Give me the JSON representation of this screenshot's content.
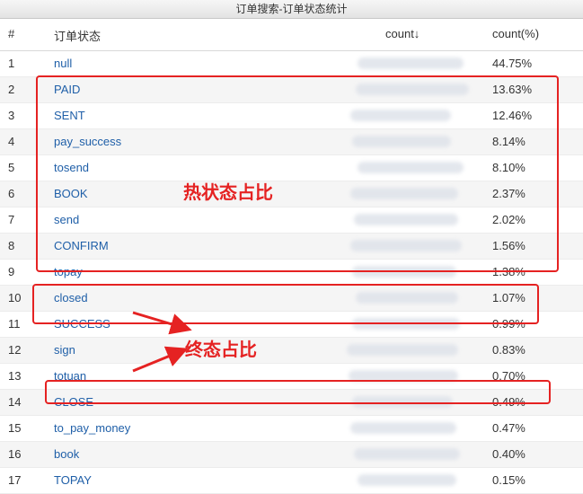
{
  "window": {
    "title": "订单搜索-订单状态统计"
  },
  "table": {
    "columns": [
      "#",
      "订单状态",
      "count↓",
      "count(%)"
    ],
    "rows": [
      {
        "idx": "1",
        "status": "null",
        "pct": "44.75%"
      },
      {
        "idx": "2",
        "status": "PAID",
        "pct": "13.63%"
      },
      {
        "idx": "3",
        "status": "SENT",
        "pct": "12.46%"
      },
      {
        "idx": "4",
        "status": "pay_success",
        "pct": "8.14%"
      },
      {
        "idx": "5",
        "status": "tosend",
        "pct": "8.10%"
      },
      {
        "idx": "6",
        "status": "BOOK",
        "pct": "2.37%"
      },
      {
        "idx": "7",
        "status": "send",
        "pct": "2.02%"
      },
      {
        "idx": "8",
        "status": "CONFIRM",
        "pct": "1.56%"
      },
      {
        "idx": "9",
        "status": "topay",
        "pct": "1.38%"
      },
      {
        "idx": "10",
        "status": "closed",
        "pct": "1.07%"
      },
      {
        "idx": "11",
        "status": "SUCCESS",
        "pct": "0.99%"
      },
      {
        "idx": "12",
        "status": "sign",
        "pct": "0.83%"
      },
      {
        "idx": "13",
        "status": "totuan",
        "pct": "0.70%"
      },
      {
        "idx": "14",
        "status": "CLOSE",
        "pct": "0.49%"
      },
      {
        "idx": "15",
        "status": "to_pay_money",
        "pct": "0.47%"
      },
      {
        "idx": "16",
        "status": "book",
        "pct": "0.40%"
      },
      {
        "idx": "17",
        "status": "TOPAY",
        "pct": "0.15%"
      }
    ]
  },
  "annotations": {
    "hot_label": "热状态占比",
    "final_label": "终态占比",
    "color": "#e52222"
  }
}
